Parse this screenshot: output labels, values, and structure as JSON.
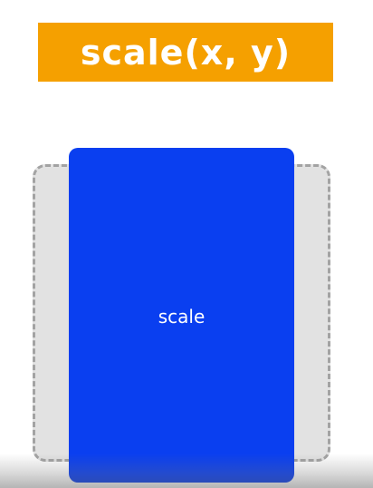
{
  "title": {
    "text": "scale(x, y)",
    "background_color": "#f5a000",
    "text_color": "#ffffff"
  },
  "original_box": {
    "fill_color": "#e2e2e2",
    "border_color": "#a3a3a3",
    "border_style": "dashed"
  },
  "scaled_box": {
    "label": "scale",
    "fill_color": "#0a3ff0",
    "text_color": "#ffffff"
  }
}
